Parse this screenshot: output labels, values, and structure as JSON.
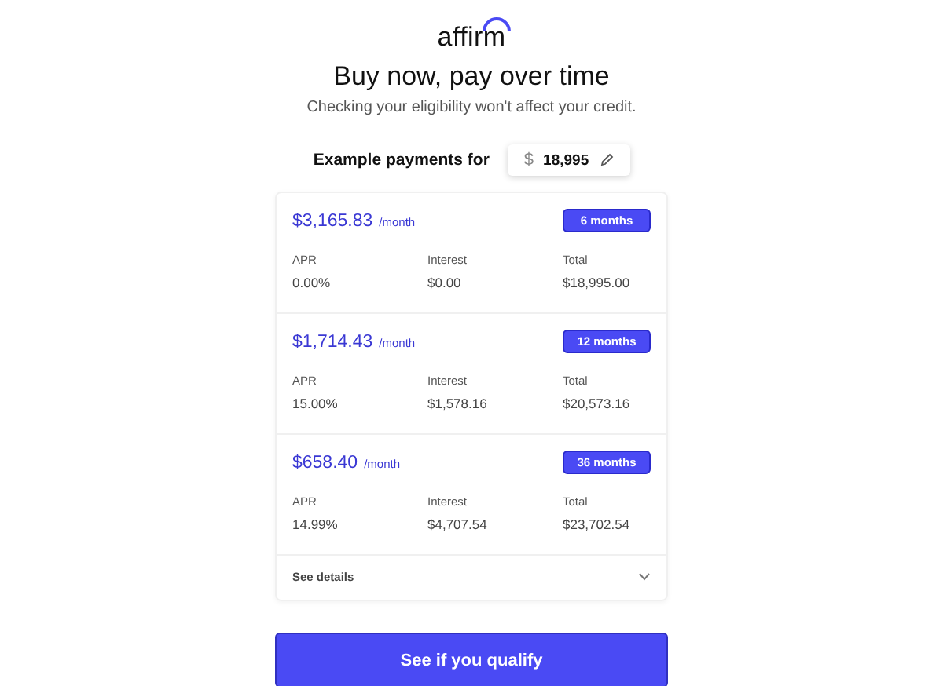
{
  "logo": {
    "text": "affirm"
  },
  "heading": "Buy now, pay over time",
  "subheading": "Checking your eligibility won't affect your credit.",
  "amount": {
    "label": "Example payments for",
    "currency": "$",
    "value": "18,995"
  },
  "plans": [
    {
      "monthly": "$3,165.83",
      "per": "/month",
      "term": "6 months",
      "fields": [
        {
          "label": "APR",
          "value": "0.00%"
        },
        {
          "label": "Interest",
          "value": "$0.00"
        },
        {
          "label": "Total",
          "value": "$18,995.00"
        }
      ]
    },
    {
      "monthly": "$1,714.43",
      "per": "/month",
      "term": "12 months",
      "fields": [
        {
          "label": "APR",
          "value": "15.00%"
        },
        {
          "label": "Interest",
          "value": "$1,578.16"
        },
        {
          "label": "Total",
          "value": "$20,573.16"
        }
      ]
    },
    {
      "monthly": "$658.40",
      "per": "/month",
      "term": "36 months",
      "fields": [
        {
          "label": "APR",
          "value": "14.99%"
        },
        {
          "label": "Interest",
          "value": "$4,707.54"
        },
        {
          "label": "Total",
          "value": "$23,702.54"
        }
      ]
    }
  ],
  "details": {
    "label": "See details",
    "expanded": false
  },
  "cta": "See if you qualify"
}
